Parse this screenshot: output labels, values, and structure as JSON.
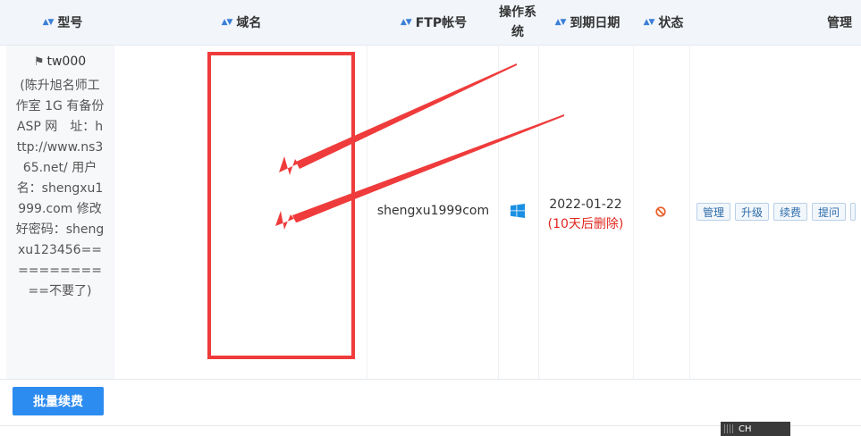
{
  "table": {
    "headers": {
      "model": "型号",
      "domain": "域名",
      "ftp": "FTP帐号",
      "os_line1": "操作系",
      "os_line2": "统",
      "expiry": "到期日期",
      "status": "状态",
      "manage": "管理"
    },
    "rows": [
      {
        "model_name": "tw000",
        "model_desc": "(陈升旭名师工作室 1G 有备份 ASP 网　址：http://www.ns365.net/ 用户名：shengxu1999.com 修改好密码：shengxu123456============不要了)",
        "domain": "",
        "ftp_account": "shengxu1999com",
        "os_icon": "windows-icon",
        "expiry_date": "2022-01-22",
        "expiry_note": "(10天后删除)",
        "status_icon": "no-entry-icon",
        "actions": [
          "管理",
          "升级",
          "续费",
          "提问"
        ]
      }
    ]
  },
  "batch_renew_label": "批量续费",
  "ime_label": "CH",
  "colors": {
    "accent": "#2d8cf0",
    "annotation_red": "#ef3b3b",
    "expiry_note": "#e0261e"
  }
}
